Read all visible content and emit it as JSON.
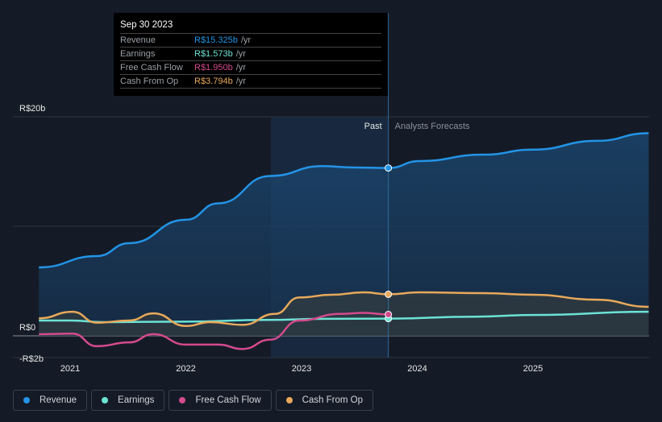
{
  "tooltip": {
    "date": "Sep 30 2023",
    "rows": [
      {
        "label": "Revenue",
        "value": "R$15.325b",
        "unit": "/yr",
        "color": "#2394e6"
      },
      {
        "label": "Earnings",
        "value": "R$1.573b",
        "unit": "/yr",
        "color": "#6ce3d4"
      },
      {
        "label": "Free Cash Flow",
        "value": "R$1.950b",
        "unit": "/yr",
        "color": "#d44a8c"
      },
      {
        "label": "Cash From Op",
        "value": "R$3.794b",
        "unit": "/yr",
        "color": "#e8a95a"
      }
    ]
  },
  "chart_data": {
    "type": "line",
    "yunit": "R$ billions",
    "ylim": [
      -2,
      20
    ],
    "yticks": [
      {
        "v": 20,
        "label": "R$20b"
      },
      {
        "v": 0,
        "label": "R$0"
      },
      {
        "v": -2,
        "label": "-R$2b"
      }
    ],
    "xlim": [
      2020.73,
      2026.0
    ],
    "xticks": [
      {
        "v": 2021,
        "label": "2021"
      },
      {
        "v": 2022,
        "label": "2022"
      },
      {
        "v": 2023,
        "label": "2023"
      },
      {
        "v": 2024,
        "label": "2024"
      },
      {
        "v": 2025,
        "label": "2025"
      }
    ],
    "divider": 2023.75,
    "past_label": "Past",
    "forecast_label": "Analysts Forecasts",
    "series": [
      {
        "name": "Revenue",
        "color": "#2394e6",
        "points": [
          [
            2020.73,
            6.25
          ],
          [
            2021.23,
            7.28
          ],
          [
            2021.51,
            8.46
          ],
          [
            2022.0,
            10.6
          ],
          [
            2022.28,
            12.1
          ],
          [
            2022.73,
            14.6
          ],
          [
            2023.18,
            15.5
          ],
          [
            2023.46,
            15.37
          ],
          [
            2023.75,
            15.325
          ],
          [
            2024.02,
            15.96
          ],
          [
            2024.57,
            16.54
          ],
          [
            2025.0,
            17.0
          ],
          [
            2025.55,
            17.8
          ],
          [
            2026.0,
            18.5
          ]
        ]
      },
      {
        "name": "Earnings",
        "color": "#6ce3d4",
        "points": [
          [
            2020.73,
            1.4
          ],
          [
            2021.0,
            1.4
          ],
          [
            2021.3,
            1.25
          ],
          [
            2022.0,
            1.3
          ],
          [
            2022.7,
            1.45
          ],
          [
            2023.2,
            1.55
          ],
          [
            2023.75,
            1.573
          ],
          [
            2024.5,
            1.75
          ],
          [
            2025.0,
            1.9
          ],
          [
            2026.0,
            2.2
          ]
        ]
      },
      {
        "name": "Free Cash Flow",
        "color": "#d44a8c",
        "points": [
          [
            2020.73,
            0.15
          ],
          [
            2021.02,
            0.2
          ],
          [
            2021.23,
            -0.95
          ],
          [
            2021.51,
            -0.6
          ],
          [
            2021.72,
            0.15
          ],
          [
            2022.0,
            -0.8
          ],
          [
            2022.28,
            -0.8
          ],
          [
            2022.49,
            -1.2
          ],
          [
            2022.73,
            -0.35
          ],
          [
            2022.98,
            1.4
          ],
          [
            2023.33,
            2.0
          ],
          [
            2023.54,
            2.1
          ],
          [
            2023.75,
            1.95
          ]
        ]
      },
      {
        "name": "Cash From Op",
        "color": "#e8a95a",
        "points": [
          [
            2020.73,
            1.6
          ],
          [
            2021.02,
            2.2
          ],
          [
            2021.23,
            1.2
          ],
          [
            2021.51,
            1.4
          ],
          [
            2021.72,
            2.05
          ],
          [
            2022.0,
            0.9
          ],
          [
            2022.21,
            1.25
          ],
          [
            2022.49,
            1.0
          ],
          [
            2022.77,
            2.0
          ],
          [
            2022.98,
            3.5
          ],
          [
            2023.26,
            3.75
          ],
          [
            2023.54,
            3.97
          ],
          [
            2023.75,
            3.794
          ],
          [
            2024.02,
            3.97
          ],
          [
            2024.57,
            3.9
          ],
          [
            2025.0,
            3.75
          ],
          [
            2025.55,
            3.3
          ],
          [
            2026.0,
            2.65
          ]
        ]
      }
    ]
  },
  "legend": [
    {
      "label": "Revenue",
      "color": "#2394e6"
    },
    {
      "label": "Earnings",
      "color": "#6ce3d4"
    },
    {
      "label": "Free Cash Flow",
      "color": "#d44a8c"
    },
    {
      "label": "Cash From Op",
      "color": "#e8a95a"
    }
  ]
}
